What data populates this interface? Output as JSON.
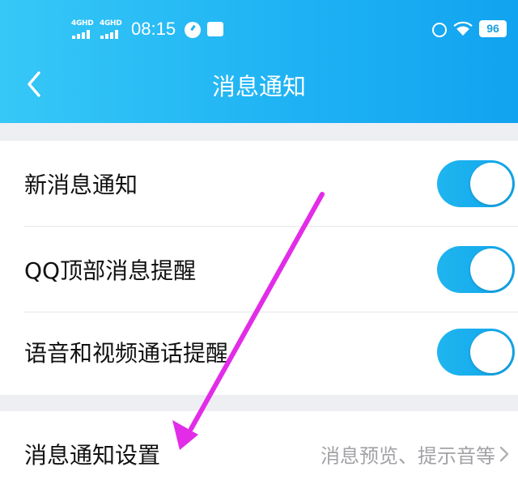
{
  "status_bar": {
    "network_1": "4GHD",
    "network_2": "4GHD",
    "time": "08:15",
    "battery": "96"
  },
  "nav": {
    "title": "消息通知"
  },
  "settings": {
    "new_message_notification": {
      "label": "新消息通知",
      "enabled": true
    },
    "qq_top_message_alert": {
      "label": "QQ顶部消息提醒",
      "enabled": true
    },
    "voice_video_call_alert": {
      "label": "语音和视频通话提醒",
      "enabled": true
    },
    "message_notification_settings": {
      "label": "消息通知设置",
      "value": "消息预览、提示音等"
    }
  },
  "annotation": {
    "arrow_color": "#e22ce8"
  },
  "colors": {
    "header_blue": "#1fb3f4",
    "toggle_blue": "#1aaeee",
    "background": "#eeeff3"
  }
}
